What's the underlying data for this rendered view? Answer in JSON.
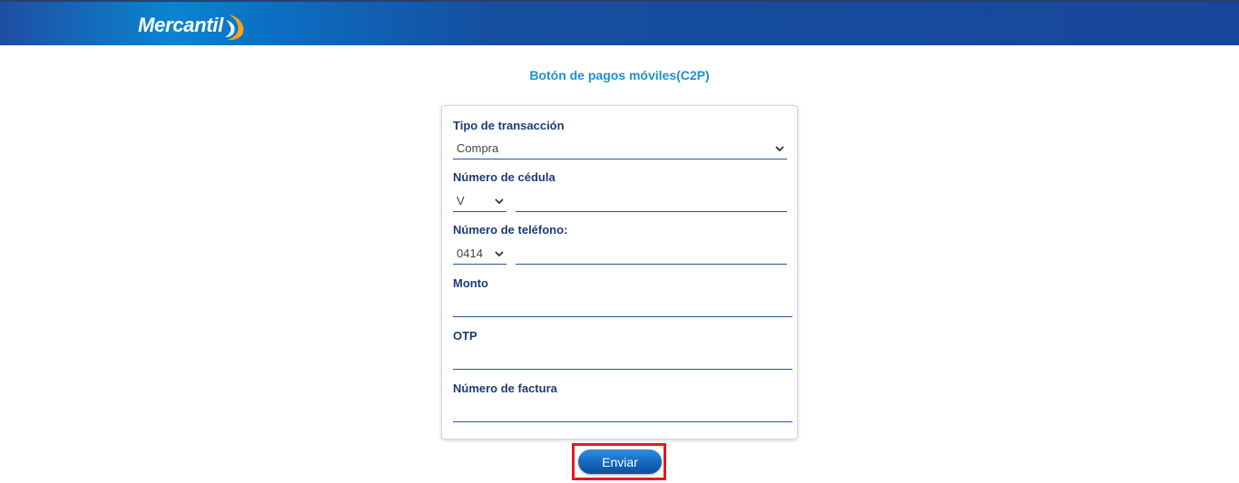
{
  "header": {
    "logo_text": "Mercantil",
    "colors": {
      "bar_dark": "#17479c",
      "bar_light": "#0a84d0",
      "logo_orange": "#f7a21b"
    }
  },
  "page": {
    "title": "Botón de pagos móviles(C2P)"
  },
  "form": {
    "tipo_label": "Tipo de transacción",
    "tipo_value": "Compra",
    "cedula_label": "Número de cédula",
    "cedula_prefix": "V",
    "cedula_value": "",
    "telefono_label": "Número de teléfono:",
    "telefono_prefix": "0414",
    "telefono_value": "",
    "monto_label": "Monto",
    "monto_value": "",
    "otp_label": "OTP",
    "otp_value": "",
    "factura_label": "Número de factura",
    "factura_value": "",
    "dropdown_icon": "chevron-down-icon"
  },
  "actions": {
    "submit_label": "Enviar",
    "highlight_color": "#e01a22"
  }
}
